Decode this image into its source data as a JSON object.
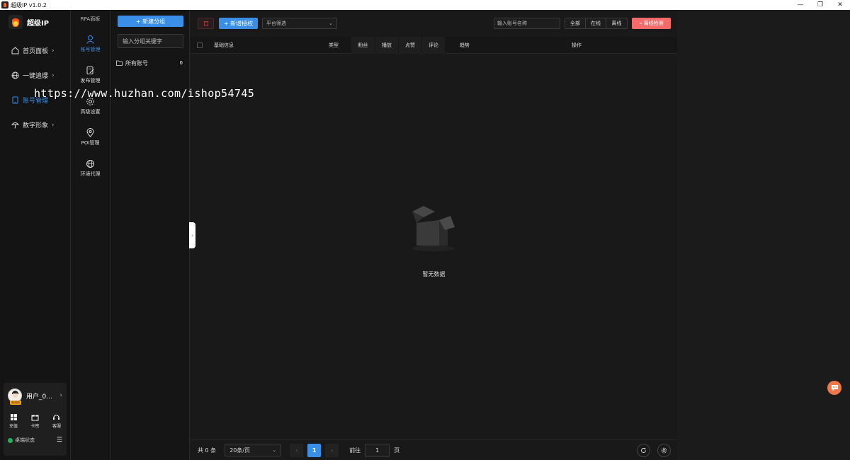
{
  "window": {
    "title": "超级IP v1.0.2",
    "controls": [
      "—",
      "❐",
      "✕"
    ]
  },
  "brand": {
    "name": "超级IP"
  },
  "leftnav": {
    "items": [
      {
        "label": "首页面板",
        "icon": "home-icon"
      },
      {
        "label": "一键追爆",
        "icon": "globe-icon"
      },
      {
        "label": "账号管理",
        "icon": "tablet-icon",
        "active": true
      },
      {
        "label": "数字形象",
        "icon": "umbrella-icon"
      }
    ]
  },
  "user": {
    "name": "用户_0...",
    "badge": "普通版",
    "tools": [
      {
        "label": "充值",
        "icon": "grid-icon"
      },
      {
        "label": "卡密",
        "icon": "gift-icon"
      },
      {
        "label": "客服",
        "icon": "headset-icon"
      }
    ],
    "status": "桌端状态"
  },
  "rpa": {
    "header": "RPA面板",
    "items": [
      {
        "label": "账号管理",
        "icon": "user-icon",
        "active": true
      },
      {
        "label": "发布管理",
        "icon": "edit-doc-icon"
      },
      {
        "label": "高级设置",
        "icon": "settings-icon"
      },
      {
        "label": "POI管理",
        "icon": "location-pin-icon"
      },
      {
        "label": "环境代理",
        "icon": "globe-icon"
      }
    ]
  },
  "groups": {
    "new_button": "+ 新建分组",
    "search_placeholder": "输入分组关键字",
    "items": [
      {
        "label": "所有账号",
        "count": "0"
      }
    ]
  },
  "toolbar": {
    "delete_icon": "trash-icon",
    "auth_button": "+ 新增授权",
    "platform_placeholder": "平台筛选",
    "account_search_placeholder": "输入账号名称",
    "filters": [
      "全部",
      "在线",
      "离线"
    ],
    "offline_check": "离线检测"
  },
  "table": {
    "columns": [
      "基础信息",
      "类型",
      "粉丝",
      "播放",
      "点赞",
      "评论",
      "趋势",
      "操作"
    ],
    "empty_text": "暂无数据"
  },
  "pagination": {
    "total": "共 0 条",
    "page_size": "20条/页",
    "prev": "‹",
    "current_page": "1",
    "next": "›",
    "goto_label": "前往",
    "goto_value": "1",
    "page_unit": "页"
  },
  "watermark": "https://www.huzhan.com/ishop54745",
  "colors": {
    "accent": "#3a8ee6",
    "danger": "#f36b6b",
    "online": "#1fb35c",
    "chat": "#f07848"
  }
}
